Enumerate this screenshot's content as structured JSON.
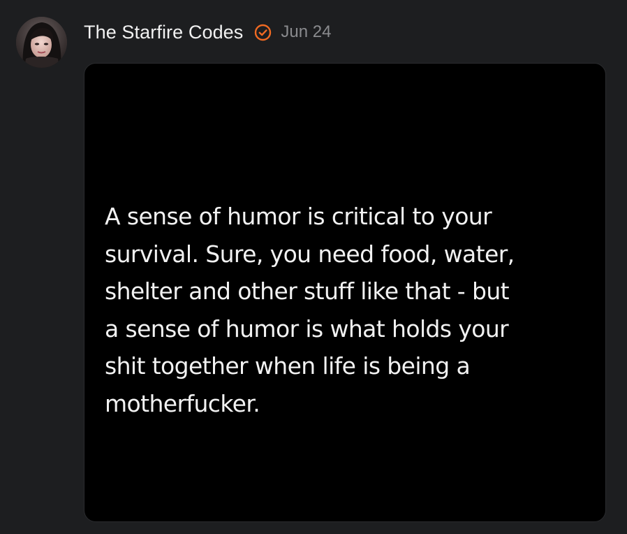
{
  "post": {
    "author_name": "The Starfire Codes",
    "verified_icon": "check-circle-icon",
    "date": "Jun 24",
    "accent_color": "#f06a22",
    "image": {
      "lines": [
        "A sense of humor is critical to your",
        "survival. Sure, you need food, water,",
        "shelter and other stuff like that - but",
        "a sense of humor is what holds your",
        "shit together when life is being a",
        "motherfucker."
      ]
    }
  }
}
